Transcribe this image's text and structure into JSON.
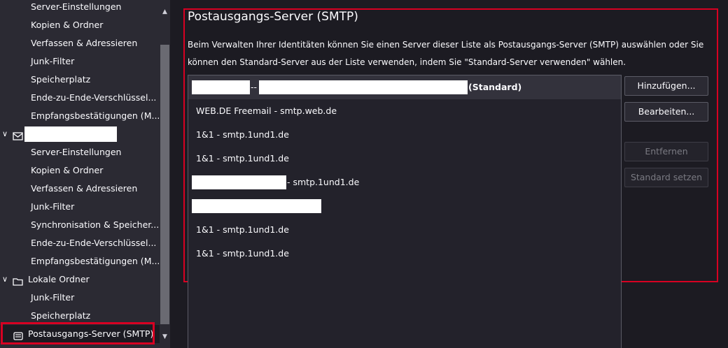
{
  "sidebar": {
    "items": [
      {
        "label": "Server-Einstellungen"
      },
      {
        "label": "Kopien & Ordner"
      },
      {
        "label": "Verfassen & Adressieren"
      },
      {
        "label": "Junk-Filter"
      },
      {
        "label": "Speicherplatz"
      },
      {
        "label": "Ende-zu-Ende-Verschlüssel..."
      },
      {
        "label": "Empfangsbestätigungen (M..."
      },
      {
        "label": ""
      },
      {
        "label": "Server-Einstellungen"
      },
      {
        "label": "Kopien & Ordner"
      },
      {
        "label": "Verfassen & Adressieren"
      },
      {
        "label": "Junk-Filter"
      },
      {
        "label": "Synchronisation & Speicher..."
      },
      {
        "label": "Ende-zu-Ende-Verschlüssel..."
      },
      {
        "label": "Empfangsbestätigungen (M..."
      },
      {
        "label": "Lokale Ordner"
      },
      {
        "label": "Junk-Filter"
      },
      {
        "label": "Speicherplatz"
      },
      {
        "label": "Postausgangs-Server (SMTP)"
      }
    ]
  },
  "main": {
    "title": "Postausgangs-Server (SMTP)",
    "description_line1": "Beim Verwalten Ihrer Identitäten können Sie einen Server dieser Liste als Postausgangs-Server (SMTP) auswählen oder Sie",
    "description_line2": "können den Standard-Server aus der Liste verwenden, indem Sie \"Standard-Server verwenden\" wählen.",
    "servers": [
      {
        "label": "--",
        "suffix": "(Standard)"
      },
      {
        "label": "WEB.DE Freemail - smtp.web.de"
      },
      {
        "label": "1&1 - smtp.1und1.de"
      },
      {
        "label": "1&1 - smtp.1und1.de"
      },
      {
        "label": "- smtp.1und1.de"
      },
      {
        "label": ""
      },
      {
        "label": "1&1 - smtp.1und1.de"
      },
      {
        "label": "1&1 - smtp.1und1.de"
      }
    ],
    "buttons": {
      "add": "Hinzufügen...",
      "edit": "Bearbeiten...",
      "remove": "Entfernen",
      "set_default": "Standard setzen"
    }
  },
  "colors": {
    "accent_outline": "#d70022",
    "background": "#1c1b22",
    "sidebar": "#2b2a33"
  }
}
